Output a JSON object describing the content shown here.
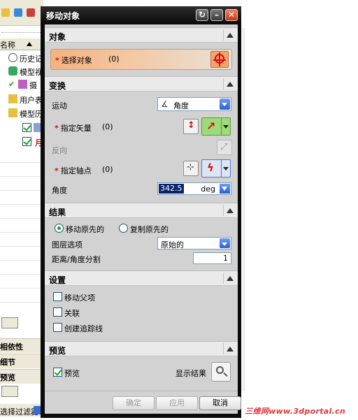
{
  "dialog": {
    "title": "移动对象",
    "sections": {
      "object": {
        "title": "对象",
        "select_label": "选择对象",
        "select_count": "(0)"
      },
      "transform": {
        "title": "变换",
        "motion_label": "运动",
        "motion_value": "角度",
        "vector_label": "指定矢量",
        "vector_count": "(0)",
        "reverse_label": "反向",
        "axis_point_label": "指定轴点",
        "axis_point_count": "(0)",
        "angle_label": "角度",
        "angle_value": "342.5",
        "angle_unit": "deg"
      },
      "result": {
        "title": "结果",
        "move_original": "移动原先的",
        "copy_original": "复制原先的",
        "layer_label": "图层选项",
        "layer_value": "原始的",
        "distance_split_label": "距离/角度分割",
        "distance_split_value": "1"
      },
      "settings": {
        "title": "设置",
        "move_parent": "移动父项",
        "associative": "关联",
        "create_trace": "创建追踪线"
      },
      "preview": {
        "title": "预览",
        "preview_label": "预览",
        "show_result": "显示结果"
      }
    },
    "buttons": {
      "ok": "确定",
      "apply": "应用",
      "cancel": "取消"
    },
    "state": {
      "move_selected": true,
      "copy_selected": false,
      "move_parent_checked": false,
      "associative_checked": false,
      "create_trace_checked": false,
      "preview_checked": true
    }
  },
  "navigator": {
    "column_header": "名称",
    "items": [
      "历史记",
      "模型视",
      "摄",
      "用户表",
      "模型历",
      "",
      "月"
    ],
    "sections": [
      "相依性",
      "细节",
      "预览"
    ],
    "filter_label": "选择过滤器"
  },
  "watermark": "三维网www.3dportal.cn",
  "colors": {
    "title_bar": "#0a0a0a",
    "dialog_body": "#d2d2d2",
    "select_bar": "#f5b181",
    "green_button": "#9ddb7a",
    "accent_blue": "#2d5fd0",
    "watermark": "#e0383d",
    "required_star": "#d01010"
  }
}
